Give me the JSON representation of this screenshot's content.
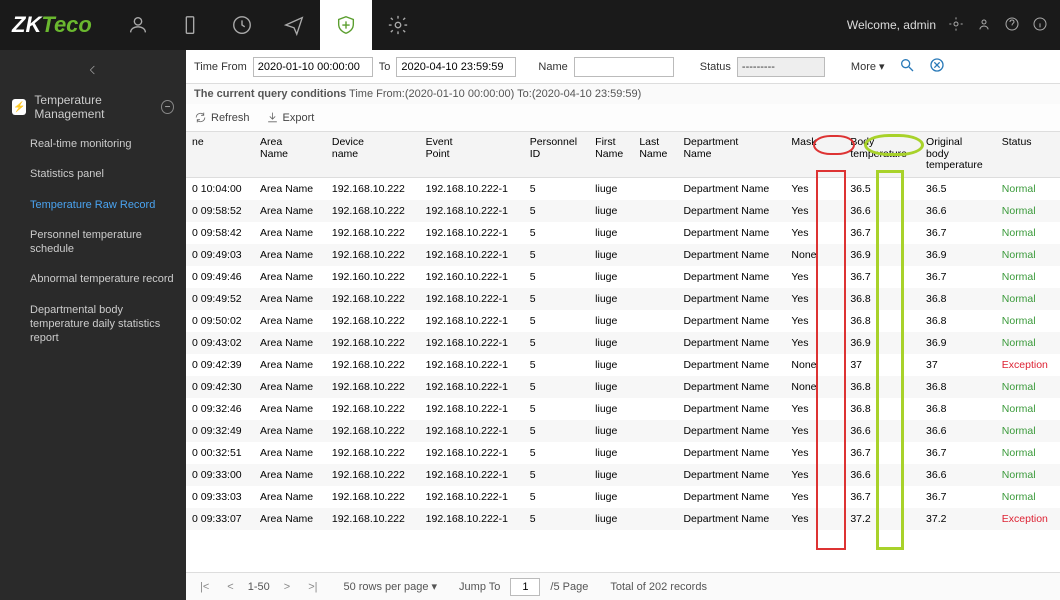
{
  "header": {
    "logo_a": "ZK",
    "logo_b": "Teco",
    "welcome": "Welcome, admin"
  },
  "sidebar": {
    "header": "Temperature Management",
    "items": [
      "Real-time monitoring",
      "Statistics panel",
      "Temperature Raw Record",
      "Personnel temperature schedule",
      "Abnormal temperature record",
      "Departmental body temperature daily statistics report"
    ]
  },
  "filter": {
    "time_from_label": "Time From",
    "time_from": "2020-01-10 00:00:00",
    "to_label": "To",
    "time_to": "2020-04-10 23:59:59",
    "name_label": "Name",
    "name_value": "",
    "status_label": "Status",
    "status_value": "---------",
    "more": "More ▾"
  },
  "conditions": {
    "label": "The current query conditions",
    "text": "Time From:(2020-01-10 00:00:00)  To:(2020-04-10 23:59:59)"
  },
  "toolbar": {
    "refresh": "Refresh",
    "export": "Export"
  },
  "table": {
    "headers": [
      "ne",
      "Area Name",
      "Device name",
      "Event Point",
      "Personnel ID",
      "First Name",
      "Last Name",
      "Department Name",
      "Mask",
      "",
      "Body temperature",
      "Original body temperature",
      "Status"
    ],
    "rows": [
      {
        "time": "0 10:04:00",
        "area": "Area Name",
        "device": "192.168.10.222",
        "event": "192.168.10.222-1",
        "pid": "5",
        "first": "liuge",
        "dept": "Department Name",
        "mask": "Yes",
        "body": "36.5",
        "orig": "36.5",
        "status": "Normal"
      },
      {
        "time": "0 09:58:52",
        "area": "Area Name",
        "device": "192.168.10.222",
        "event": "192.168.10.222-1",
        "pid": "5",
        "first": "liuge",
        "dept": "Department Name",
        "mask": "Yes",
        "body": "36.6",
        "orig": "36.6",
        "status": "Normal"
      },
      {
        "time": "0 09:58:42",
        "area": "Area Name",
        "device": "192.168.10.222",
        "event": "192.168.10.222-1",
        "pid": "5",
        "first": "liuge",
        "dept": "Department Name",
        "mask": "Yes",
        "body": "36.7",
        "orig": "36.7",
        "status": "Normal"
      },
      {
        "time": "0 09:49:03",
        "area": "Area Name",
        "device": "192.168.10.222",
        "event": "192.168.10.222-1",
        "pid": "5",
        "first": "liuge",
        "dept": "Department Name",
        "mask": "None",
        "body": "36.9",
        "orig": "36.9",
        "status": "Normal"
      },
      {
        "time": "0 09:49:46",
        "area": "Area Name",
        "device": "192.160.10.222",
        "event": "192.160.10.222-1",
        "pid": "5",
        "first": "liuge",
        "dept": "Department Name",
        "mask": "Yes",
        "body": "36.7",
        "orig": "36.7",
        "status": "Normal"
      },
      {
        "time": "0 09:49:52",
        "area": "Area Name",
        "device": "192.168.10.222",
        "event": "192.168.10.222-1",
        "pid": "5",
        "first": "liuge",
        "dept": "Department Name",
        "mask": "Yes",
        "body": "36.8",
        "orig": "36.8",
        "status": "Normal"
      },
      {
        "time": "0 09:50:02",
        "area": "Area Name",
        "device": "192.168.10.222",
        "event": "192.168.10.222-1",
        "pid": "5",
        "first": "liuge",
        "dept": "Department Name",
        "mask": "Yes",
        "body": "36.8",
        "orig": "36.8",
        "status": "Normal"
      },
      {
        "time": "0 09:43:02",
        "area": "Area Name",
        "device": "192.168.10.222",
        "event": "192.168.10.222-1",
        "pid": "5",
        "first": "liuge",
        "dept": "Department Name",
        "mask": "Yes",
        "body": "36.9",
        "orig": "36.9",
        "status": "Normal"
      },
      {
        "time": "0 09:42:39",
        "area": "Area Name",
        "device": "192.168.10.222",
        "event": "192.168.10.222-1",
        "pid": "5",
        "first": "liuge",
        "dept": "Department Name",
        "mask": "None",
        "body": "37",
        "orig": "37",
        "status": "Exception"
      },
      {
        "time": "0 09:42:30",
        "area": "Area Name",
        "device": "192.168.10.222",
        "event": "192.168.10.222-1",
        "pid": "5",
        "first": "liuge",
        "dept": "Department Name",
        "mask": "None",
        "body": "36.8",
        "orig": "36.8",
        "status": "Normal"
      },
      {
        "time": "0 09:32:46",
        "area": "Area Name",
        "device": "192.168.10.222",
        "event": "192.168.10.222-1",
        "pid": "5",
        "first": "liuge",
        "dept": "Department Name",
        "mask": "Yes",
        "body": "36.8",
        "orig": "36.8",
        "status": "Normal"
      },
      {
        "time": "0 09:32:49",
        "area": "Area Name",
        "device": "192.168.10.222",
        "event": "192.168.10.222-1",
        "pid": "5",
        "first": "liuge",
        "dept": "Department Name",
        "mask": "Yes",
        "body": "36.6",
        "orig": "36.6",
        "status": "Normal"
      },
      {
        "time": "0 00:32:51",
        "area": "Area Name",
        "device": "192.168.10.222",
        "event": "192.168.10.222-1",
        "pid": "5",
        "first": "liuge",
        "dept": "Department Name",
        "mask": "Yes",
        "body": "36.7",
        "orig": "36.7",
        "status": "Normal"
      },
      {
        "time": "0 09:33:00",
        "area": "Area Name",
        "device": "192.168.10.222",
        "event": "192.168.10.222-1",
        "pid": "5",
        "first": "liuge",
        "dept": "Department Name",
        "mask": "Yes",
        "body": "36.6",
        "orig": "36.6",
        "status": "Normal"
      },
      {
        "time": "0 09:33:03",
        "area": "Area Name",
        "device": "192.168.10.222",
        "event": "192.168.10.222-1",
        "pid": "5",
        "first": "liuge",
        "dept": "Department Name",
        "mask": "Yes",
        "body": "36.7",
        "orig": "36.7",
        "status": "Normal"
      },
      {
        "time": "0 09:33:07",
        "area": "Area Name",
        "device": "192.168.10.222",
        "event": "192.168.10.222-1",
        "pid": "5",
        "first": "liuge",
        "dept": "Department Name",
        "mask": "Yes",
        "body": "37.2",
        "orig": "37.2",
        "status": "Exception"
      }
    ]
  },
  "pager": {
    "range": "1-50",
    "per_page": "50 rows per page",
    "jump_label": "Jump To",
    "page": "1",
    "total_pages": "/5 Page",
    "total": "Total of 202 records"
  }
}
